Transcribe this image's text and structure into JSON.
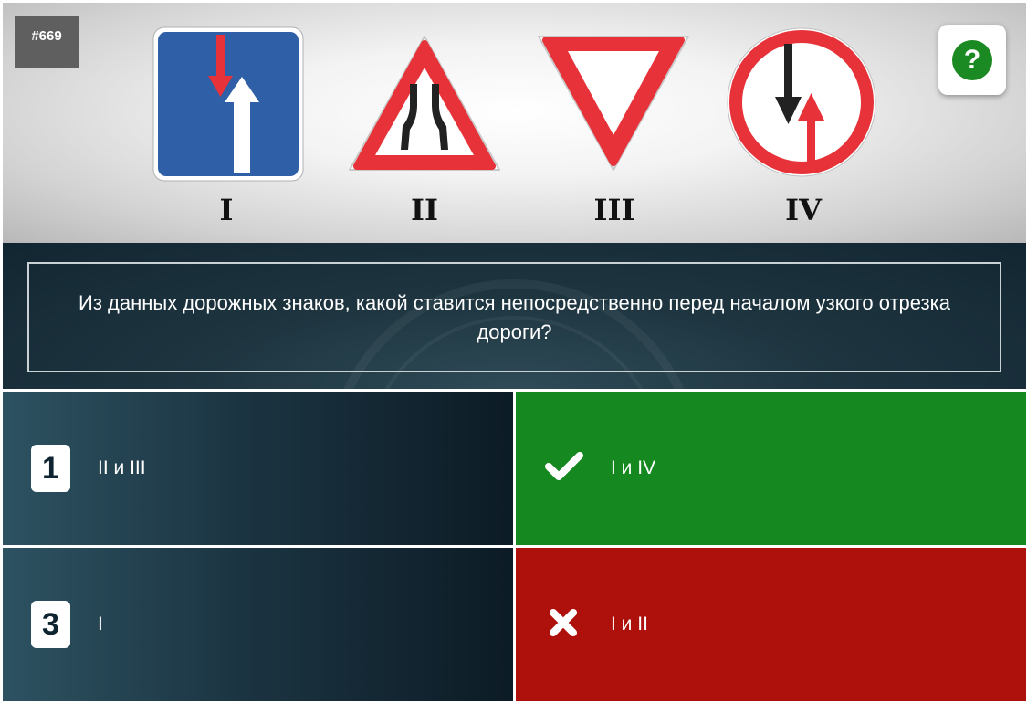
{
  "question_number": "#669",
  "help_symbol": "?",
  "signs": [
    {
      "numeral": "I",
      "icon": "one-way-lane-priority-sign-icon"
    },
    {
      "numeral": "II",
      "icon": "road-narrows-warning-sign-icon"
    },
    {
      "numeral": "III",
      "icon": "yield-sign-icon"
    },
    {
      "numeral": "IV",
      "icon": "give-way-to-oncoming-traffic-sign-icon"
    }
  ],
  "question": "Из данных дорожных знаков, какой ставится непосредственно перед началом узкого отрезка дороги?",
  "answers": [
    {
      "badge": "1",
      "text": "II и III",
      "state": "neutral",
      "icon": "number-badge"
    },
    {
      "badge": "",
      "text": "I и IV",
      "state": "correct",
      "icon": "check-icon"
    },
    {
      "badge": "3",
      "text": "I",
      "state": "neutral",
      "icon": "number-badge"
    },
    {
      "badge": "",
      "text": "I и II",
      "state": "wrong",
      "icon": "cross-icon"
    }
  ],
  "colors": {
    "correct": "#15891f",
    "wrong": "#ae100b",
    "neutral": "#1c3543",
    "sign_blue": "#2f5fa6",
    "sign_red": "#e63238",
    "help_green": "#1c8a23"
  }
}
